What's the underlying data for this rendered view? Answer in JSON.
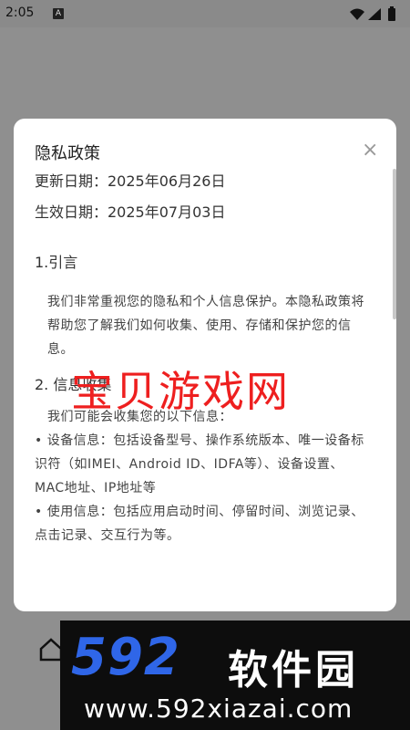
{
  "status_bar": {
    "time": "2:05",
    "indicator": "A",
    "icons": [
      "wifi-icon",
      "signal-icon",
      "battery-icon"
    ]
  },
  "dialog": {
    "title": "隐私政策",
    "close_label": "×",
    "updated": "更新日期：2025年06月26日",
    "effective": "生效日期：2025年07月03日",
    "sections": [
      {
        "heading": "1.引言",
        "paragraphs": [
          "我们非常重视您的隐私和个人信息保护。本隐私政策将帮助您了解我们如何收集、使用、存储和保护您的信息。"
        ]
      },
      {
        "heading": "2. 信息收集",
        "paragraphs": [
          "我们可能会收集您的以下信息：",
          "• 设备信息：包括设备型号、操作系统版本、唯一设备标识符（如IMEI、Android ID、IDFA等）、设备设置、MAC地址、IP地址等",
          "• 使用信息：包括应用启动时间、停留时间、浏览记录、点击记录、交互行为等。"
        ]
      }
    ]
  },
  "watermark": "宝贝游戏网",
  "banner": {
    "number": "592",
    "name": "软件园",
    "url": "www.592xiazai.com"
  },
  "colors": {
    "watermark": "#ee1f1f",
    "logo_blue": "#2f66e8"
  }
}
